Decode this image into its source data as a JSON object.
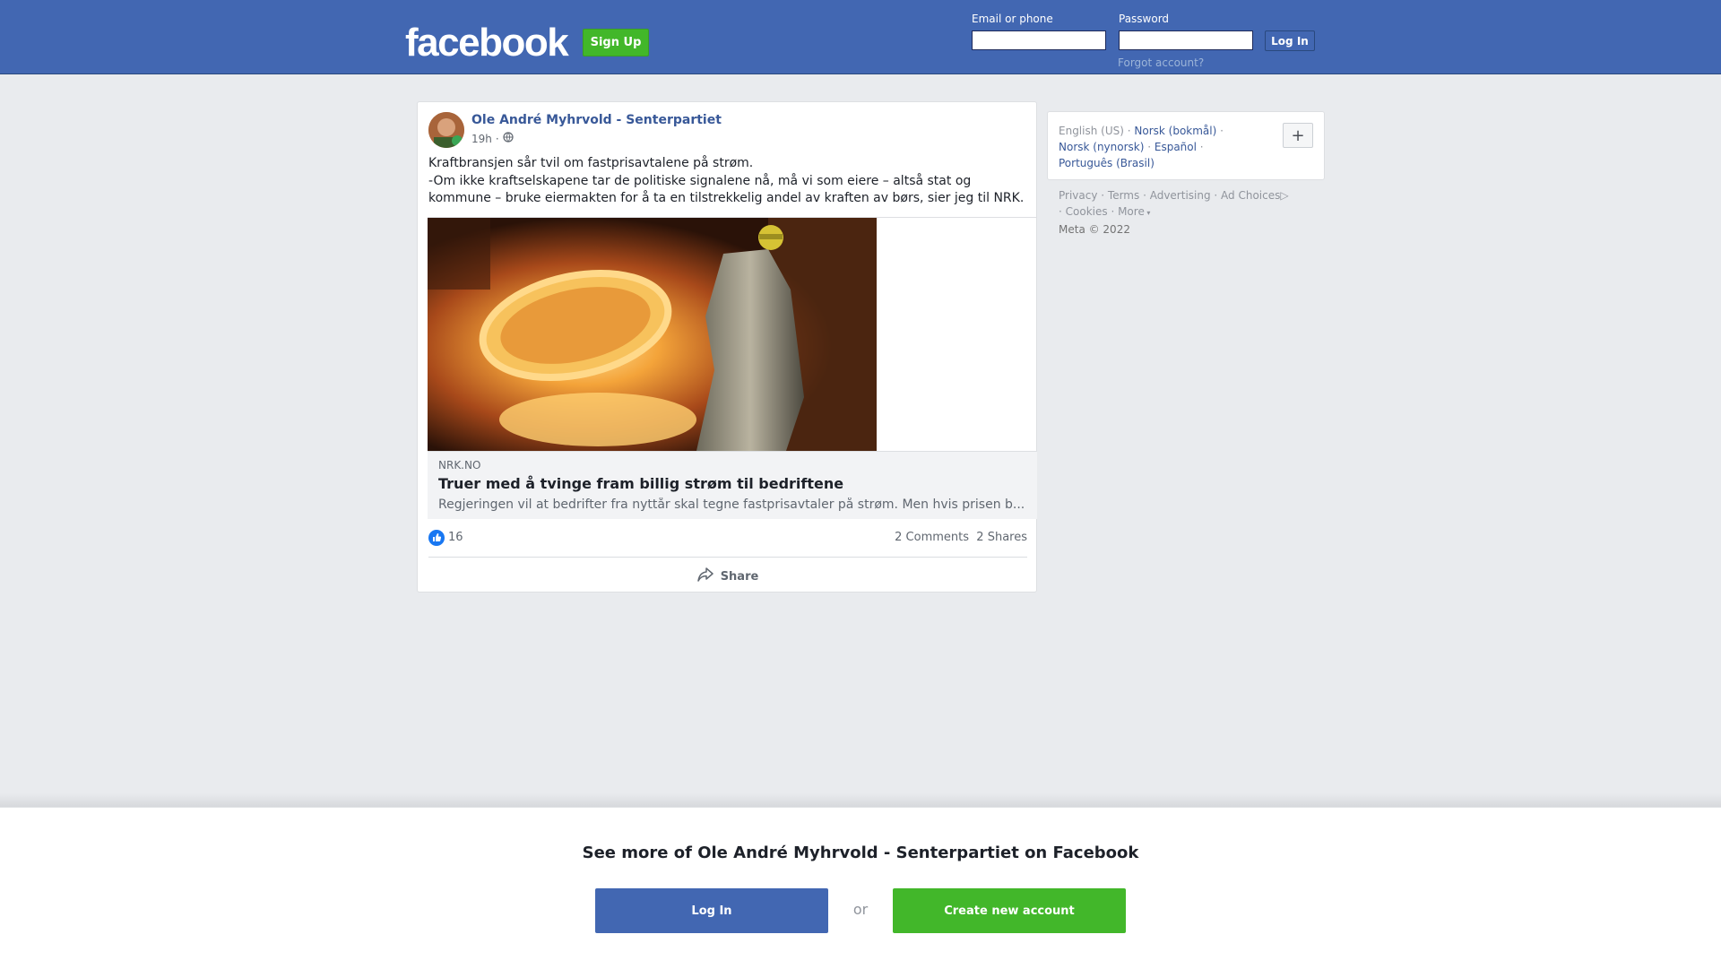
{
  "header": {
    "logo_text": "facebook",
    "signup_label": "Sign Up",
    "email_label": "Email or phone",
    "password_label": "Password",
    "login_label": "Log In",
    "forgot_label": "Forgot account?"
  },
  "post": {
    "author": "Ole André Myhrvold - Senterpartiet",
    "time": "19h",
    "text_lines": [
      "Kraftbransjen sår tvil om fastprisavtalene på strøm.",
      "-Om ikke kraftselskapene tar de politiske signalene nå, må vi som eiere – altså stat og",
      "kommune – bruke eiermakten for å ta en tilstrekkelig andel av kraften av børs, sier jeg til NRK."
    ],
    "link": {
      "domain": "NRK.NO",
      "title": "Truer med å tvinge fram billig strøm til bedriftene",
      "description": "Regjeringen vil at bedrifter fra nyttår skal tegne fastprisavtaler på strøm. Men hvis prisen b..."
    },
    "likes": "16",
    "comments": "2 Comments",
    "shares": "2 Shares",
    "share_label": "Share"
  },
  "sidebar": {
    "languages": {
      "current": "English (US)",
      "others": [
        "Norsk (bokmål)",
        "Norsk (nynorsk)",
        "Español",
        "Português (Brasil)"
      ]
    },
    "footer_links": [
      "Privacy",
      "Terms",
      "Advertising",
      "Ad Choices",
      "Cookies",
      "More"
    ],
    "copyright": "Meta © 2022"
  },
  "banner": {
    "title": "See more of Ole André Myhrvold - Senterpartiet on Facebook",
    "login_label": "Log In",
    "or_label": "or",
    "create_label": "Create new account"
  },
  "colors": {
    "brand_blue": "#4267b2",
    "signup_green": "#42b72a",
    "link_blue": "#385898",
    "page_bg": "#e9ebee"
  }
}
